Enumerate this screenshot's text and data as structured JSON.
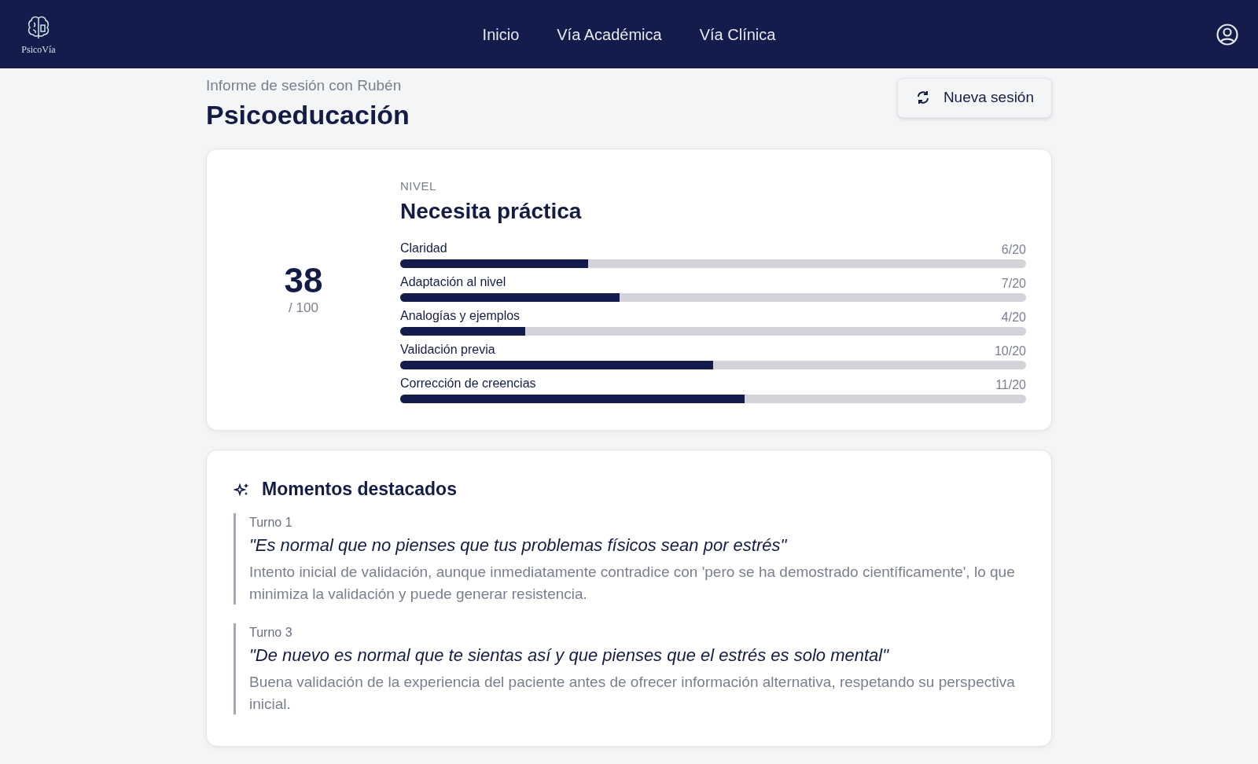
{
  "brand": {
    "name": "PsicoVía"
  },
  "nav": [
    {
      "label": "Inicio"
    },
    {
      "label": "Vía Académica"
    },
    {
      "label": "Vía Clínica"
    }
  ],
  "header": {
    "subtitle": "Informe de sesión con Rubén",
    "title": "Psicoeducación",
    "button": "Nueva sesión"
  },
  "score": {
    "value": "38",
    "max": "/ 100",
    "level_label": "NIVEL",
    "level_name": "Necesita práctica"
  },
  "criteria": [
    {
      "name": "Claridad",
      "reading": "6/20",
      "level": 0.3
    },
    {
      "name": "Adaptación al nivel",
      "reading": "7/20",
      "level": 0.35
    },
    {
      "name": "Analogías y ejemplos",
      "reading": "4/20",
      "level": 0.2
    },
    {
      "name": "Validación previa",
      "reading": "10/20",
      "level": 0.5
    },
    {
      "name": "Corrección de creencias",
      "reading": "11/20",
      "level": 0.55
    }
  ],
  "highlights": {
    "title": "Momentos destacados",
    "items": [
      {
        "turn": "Turno 1",
        "quote": "\"Es normal que no pienses que tus problemas físicos sean por estrés\"",
        "comment": "Intento inicial de validación, aunque inmediatamente contradice con 'pero se ha demostrado científicamente', lo que minimiza la validación y puede generar resistencia."
      },
      {
        "turn": "Turno 3",
        "quote": "\"De nuevo es normal que te sientas así y que pienses que el estrés es solo mental\"",
        "comment": "Buena validación de la experiencia del paciente antes de ofrecer información alternativa, respetando su perspectiva inicial."
      }
    ]
  }
}
